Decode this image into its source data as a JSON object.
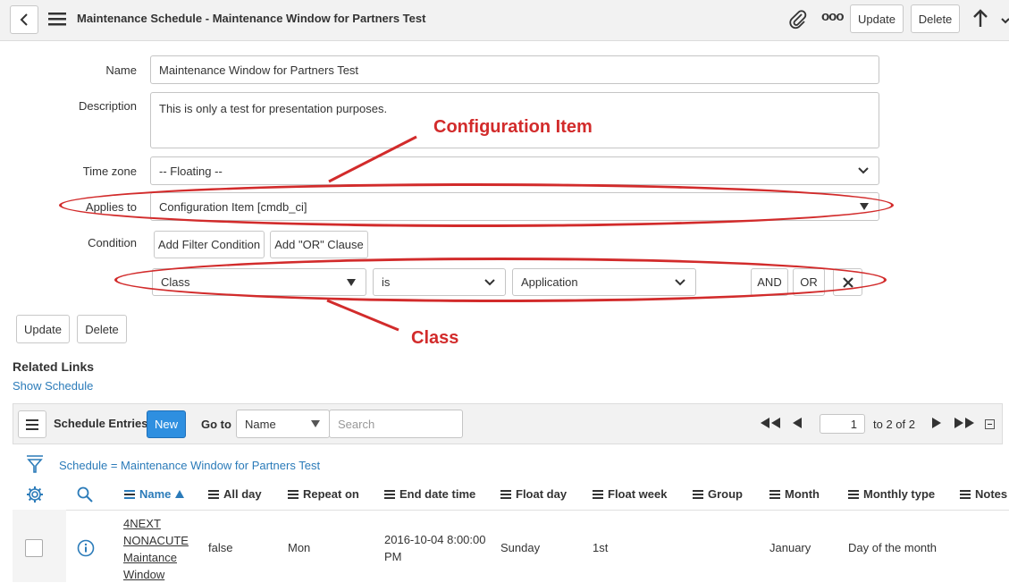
{
  "header": {
    "title": "Maintenance Schedule - Maintenance Window for Partners Test",
    "update_label": "Update",
    "delete_label": "Delete",
    "more_label": "ooo"
  },
  "form": {
    "name_label": "Name",
    "name_value": "Maintenance Window for Partners Test",
    "description_label": "Description",
    "description_value": "This is only a test for presentation purposes.",
    "timezone_label": "Time zone",
    "timezone_value": "-- Floating --",
    "applies_label": "Applies to",
    "applies_value": "Configuration Item [cmdb_ci]",
    "condition_label": "Condition",
    "add_filter_label": "Add Filter Condition",
    "add_or_label": "Add \"OR\" Clause",
    "cond_field": "Class",
    "cond_operator": "is",
    "cond_value": "Application",
    "and_label": "AND",
    "or_label": "OR",
    "update_label": "Update",
    "delete_label": "Delete"
  },
  "annotations": {
    "ci_label": "Configuration Item",
    "class_label": "Class",
    "color": "#d22b2b"
  },
  "related": {
    "title": "Related Links",
    "show_schedule": "Show Schedule"
  },
  "list": {
    "title": "Schedule Entries",
    "new_label": "New",
    "goto_label": "Go to",
    "goto_field": "Name",
    "search_placeholder": "Search",
    "page_value": "1",
    "page_info": "to 2 of 2",
    "breadcrumb": "Schedule = Maintenance Window for Partners Test",
    "columns": [
      "Name",
      "All day",
      "Repeat on",
      "End date time",
      "Float day",
      "Float week",
      "Group",
      "Month",
      "Monthly type",
      "Notes"
    ],
    "rows": [
      {
        "name_lines": [
          "4NEXT",
          "NONACUTE",
          "Maintance",
          "Window"
        ],
        "all_day": "false",
        "repeat_on": "Mon",
        "end_date_lines": [
          "2016-10-04 8:00:00",
          "PM"
        ],
        "float_day": "Sunday",
        "float_week": "1st",
        "group": "",
        "month": "January",
        "monthly_type": "Day of the month"
      }
    ]
  }
}
